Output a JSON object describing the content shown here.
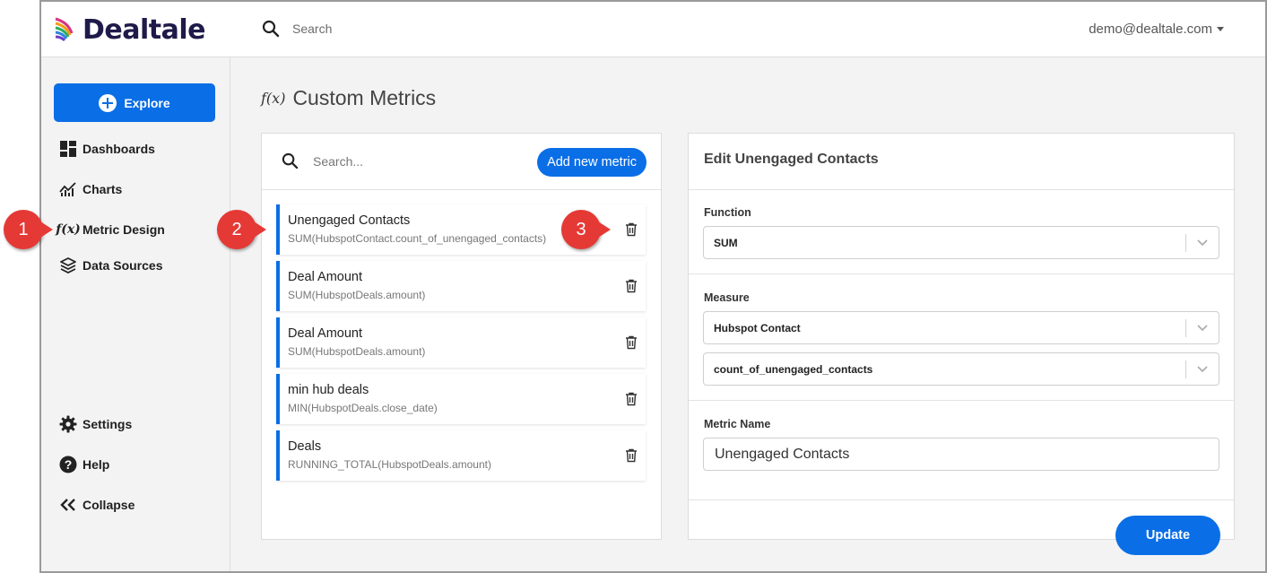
{
  "brand": {
    "name": "Dealtale",
    "accent": "#0a6ee6",
    "annotation_color": "#e53935"
  },
  "topbar": {
    "search_label": "Search",
    "user": "demo@dealtale.com"
  },
  "sidebar": {
    "explore_label": "Explore",
    "items": [
      {
        "label": "Dashboards",
        "icon": "dashboard-icon"
      },
      {
        "label": "Charts",
        "icon": "chart-icon"
      },
      {
        "label": "Metric Design",
        "icon": "function-icon"
      },
      {
        "label": "Data Sources",
        "icon": "layers-icon"
      },
      {
        "label": "Settings",
        "icon": "gear-icon"
      },
      {
        "label": "Help",
        "icon": "help-icon"
      },
      {
        "label": "Collapse",
        "icon": "chevrons-left-icon"
      }
    ]
  },
  "page": {
    "title": "Custom Metrics",
    "title_icon": "f(x)"
  },
  "metrics_list": {
    "search_placeholder": "Search...",
    "add_label": "Add new metric",
    "items": [
      {
        "name": "Unengaged Contacts",
        "expr": "SUM(HubspotContact.count_of_unengaged_contacts)"
      },
      {
        "name": "Deal Amount",
        "expr": "SUM(HubspotDeals.amount)"
      },
      {
        "name": "Deal Amount",
        "expr": "SUM(HubspotDeals.amount)"
      },
      {
        "name": "min hub deals",
        "expr": "MIN(HubspotDeals.close_date)"
      },
      {
        "name": "Deals",
        "expr": "RUNNING_TOTAL(HubspotDeals.amount)"
      }
    ]
  },
  "edit": {
    "title": "Edit Unengaged Contacts",
    "function_label": "Function",
    "function_value": "SUM",
    "measure_label": "Measure",
    "measure_source": "Hubspot Contact",
    "measure_field": "count_of_unengaged_contacts",
    "metric_name_label": "Metric Name",
    "metric_name_value": "Unengaged Contacts",
    "update_label": "Update"
  },
  "annotations": [
    "1",
    "2",
    "3"
  ]
}
